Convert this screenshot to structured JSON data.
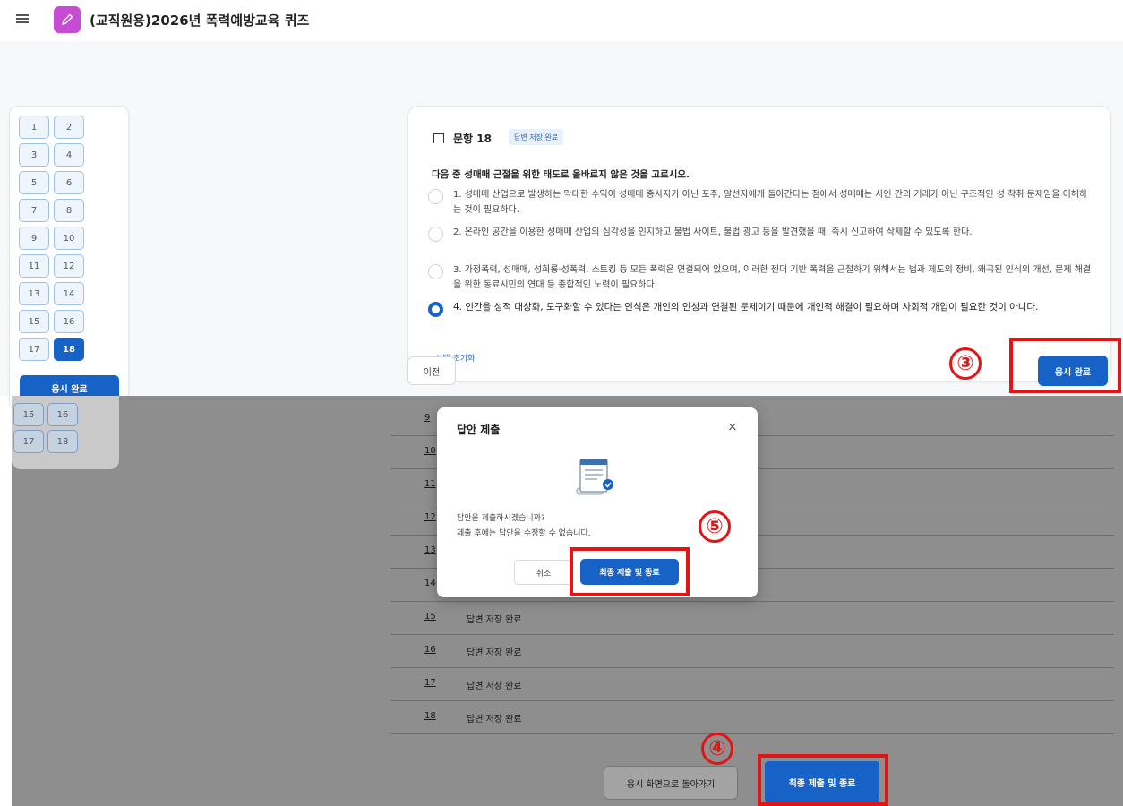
{
  "topbar": {
    "title": "(교직원용)2026년 폭력예방교육 퀴즈",
    "app_icon": "pencil-icon",
    "app_icon_color": "#c84bd6"
  },
  "nav": {
    "buttons": [
      "1",
      "2",
      "3",
      "4",
      "5",
      "6",
      "7",
      "8",
      "9",
      "10",
      "11",
      "12",
      "13",
      "14",
      "15",
      "16",
      "17",
      "18"
    ],
    "current": "18",
    "finish_label": "응시 완료"
  },
  "question": {
    "number_label": "문항 18",
    "status_badge": "답변 저장 완료",
    "stem": "다음 중 성매매 근절을 위한 태도로 올바르지 않은 것을 고르시오.",
    "options": [
      {
        "text": "1. 성매매 산업으로 발생하는 막대한 수익이 성매매 종사자가 아닌 포주, 알선자에게 돌아간다는 점에서 성매매는 사인 간의 거래가 아닌 구조적인 성 착취 문제임을 이해하는 것이 필요하다.",
        "checked": false
      },
      {
        "text": "2. 온라인 공간을 이용한 성매매 산업의 심각성을 인지하고 불법 사이트, 불법 광고 등을 발견했을 때, 즉시 신고하여 삭제할 수 있도록 한다.",
        "checked": false
      },
      {
        "text": "3. 가정폭력, 성매매, 성희롱·성폭력, 스토킹 등 모든 폭력은 연결되어 있으며, 이러한 젠더 기반 폭력을 근절하기 위해서는 법과 제도의 정비, 왜곡된 인식의 개선, 문제 해결을 위한 동료시민의 연대 등 종합적인 노력이 필요하다.",
        "checked": false
      },
      {
        "text": "4. 인간을 성적 대상화, 도구화할 수 있다는 인식은 개인의 인성과 연결된 문제이기 때문에 개인적 해결이 필요하며 사회적 개입이 필요한 것이 아니다.",
        "checked": true
      }
    ],
    "clear_label": "선택 초기화",
    "prev_label": "이전",
    "finish_label": "응시 완료"
  },
  "callouts": {
    "three": "③",
    "four": "④",
    "five": "⑤",
    "color": "#e21414"
  },
  "lower_nav": {
    "buttons": [
      "15",
      "16",
      "17",
      "18"
    ]
  },
  "summary": {
    "rows": [
      {
        "num": "9",
        "status": ""
      },
      {
        "num": "10",
        "status": ""
      },
      {
        "num": "11",
        "status": ""
      },
      {
        "num": "12",
        "status": ""
      },
      {
        "num": "13",
        "status": ""
      },
      {
        "num": "14",
        "status": ""
      },
      {
        "num": "15",
        "status": "답변 저장 완료"
      },
      {
        "num": "16",
        "status": "답변 저장 완료"
      },
      {
        "num": "17",
        "status": "답변 저장 완료"
      },
      {
        "num": "18",
        "status": "답변 저장 완료"
      }
    ],
    "back_label": "응시 화면으로 돌아가기",
    "final_label": "최종 제출 및 종료"
  },
  "modal": {
    "title": "답안 제출",
    "close": "×",
    "icon": "document-check-icon",
    "message1": "답안을 제출하시겠습니까?",
    "message2": "제출 후에는 답안을 수정할 수 없습니다.",
    "cancel_label": "취소",
    "final_label": "최종 제출 및 종료"
  },
  "colors": {
    "primary": "#1762c7",
    "callout": "#e21414"
  }
}
